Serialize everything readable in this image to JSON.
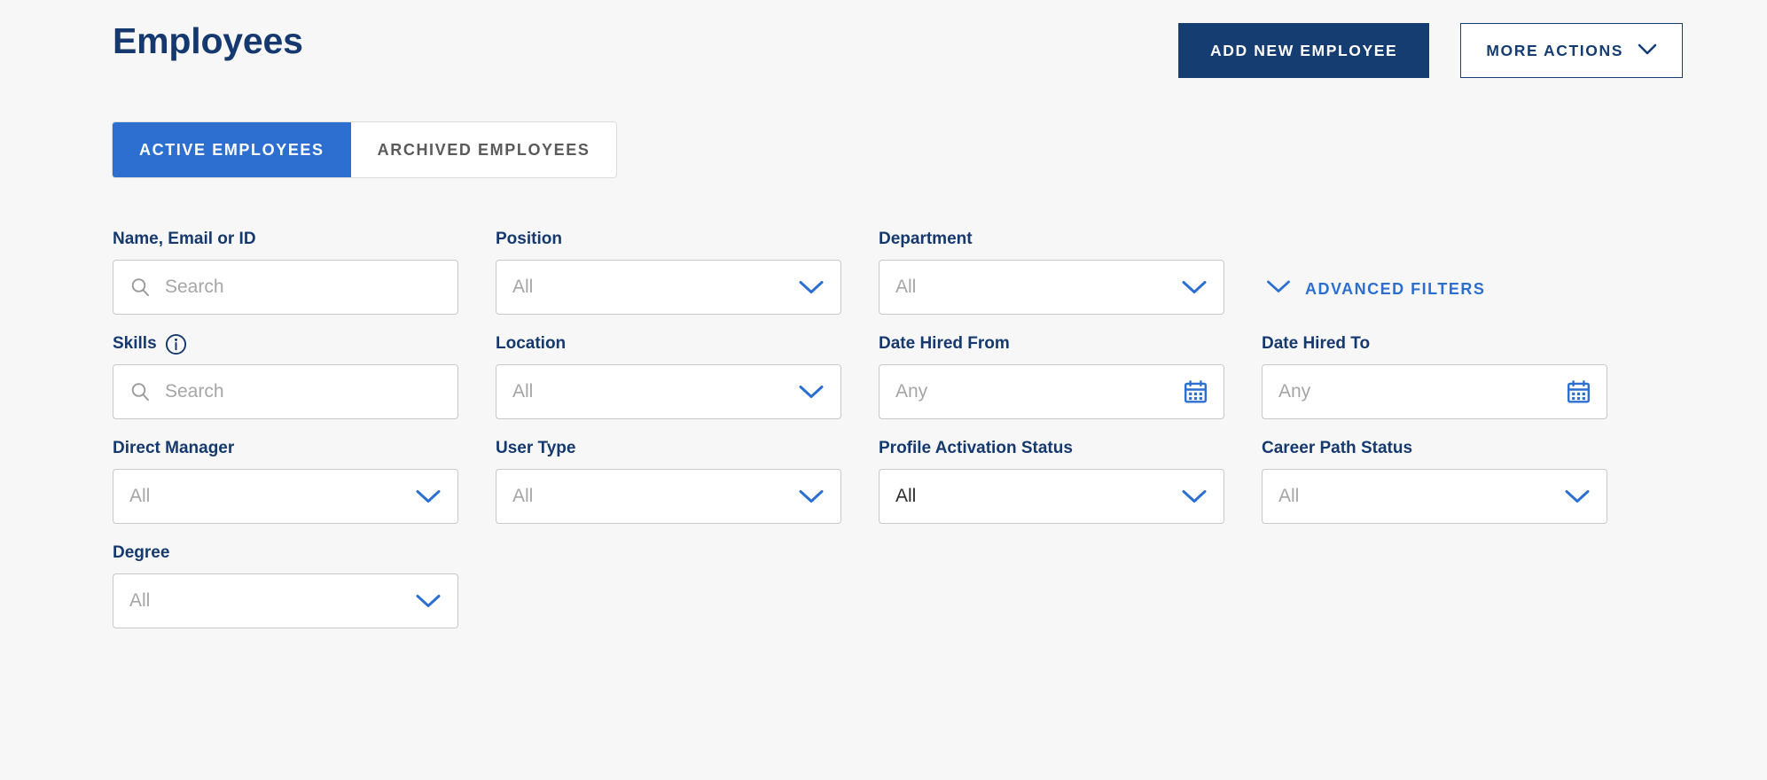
{
  "page": {
    "title": "Employees",
    "background_color": "#f7f7f7",
    "brand_navy": "#15396e",
    "brand_blue": "#2c6fd1"
  },
  "header": {
    "add_button_label": "ADD NEW EMPLOYEE",
    "more_actions_label": "MORE ACTIONS"
  },
  "tabs": [
    {
      "label": "ACTIVE EMPLOYEES",
      "active": true
    },
    {
      "label": "ARCHIVED EMPLOYEES",
      "active": false
    }
  ],
  "advanced_filters": {
    "label": "ADVANCED FILTERS"
  },
  "filters": {
    "row1": [
      {
        "label": "Name, Email or ID",
        "value": "Search",
        "filled": false,
        "control": "search"
      },
      {
        "label": "Position",
        "value": "All",
        "filled": false,
        "control": "select"
      },
      {
        "label": "Department",
        "value": "All",
        "filled": false,
        "control": "select"
      }
    ],
    "row2": [
      {
        "label": "Skills",
        "value": "Search",
        "filled": false,
        "control": "search",
        "info": true
      },
      {
        "label": "Location",
        "value": "All",
        "filled": false,
        "control": "select"
      },
      {
        "label": "Date Hired From",
        "value": "Any",
        "filled": false,
        "control": "date"
      },
      {
        "label": "Date Hired To",
        "value": "Any",
        "filled": false,
        "control": "date"
      }
    ],
    "row3": [
      {
        "label": "Direct Manager",
        "value": "All",
        "filled": false,
        "control": "select"
      },
      {
        "label": "User Type",
        "value": "All",
        "filled": false,
        "control": "select"
      },
      {
        "label": "Profile Activation Status",
        "value": "All",
        "filled": true,
        "control": "select"
      },
      {
        "label": "Career Path Status",
        "value": "All",
        "filled": false,
        "control": "select"
      }
    ],
    "row4": [
      {
        "label": "Degree",
        "value": "All",
        "filled": false,
        "control": "select"
      }
    ]
  },
  "icons": {
    "search": "search-icon",
    "chevron_down": "chevron-down-icon",
    "calendar": "calendar-icon",
    "info": "info-circle-icon"
  }
}
